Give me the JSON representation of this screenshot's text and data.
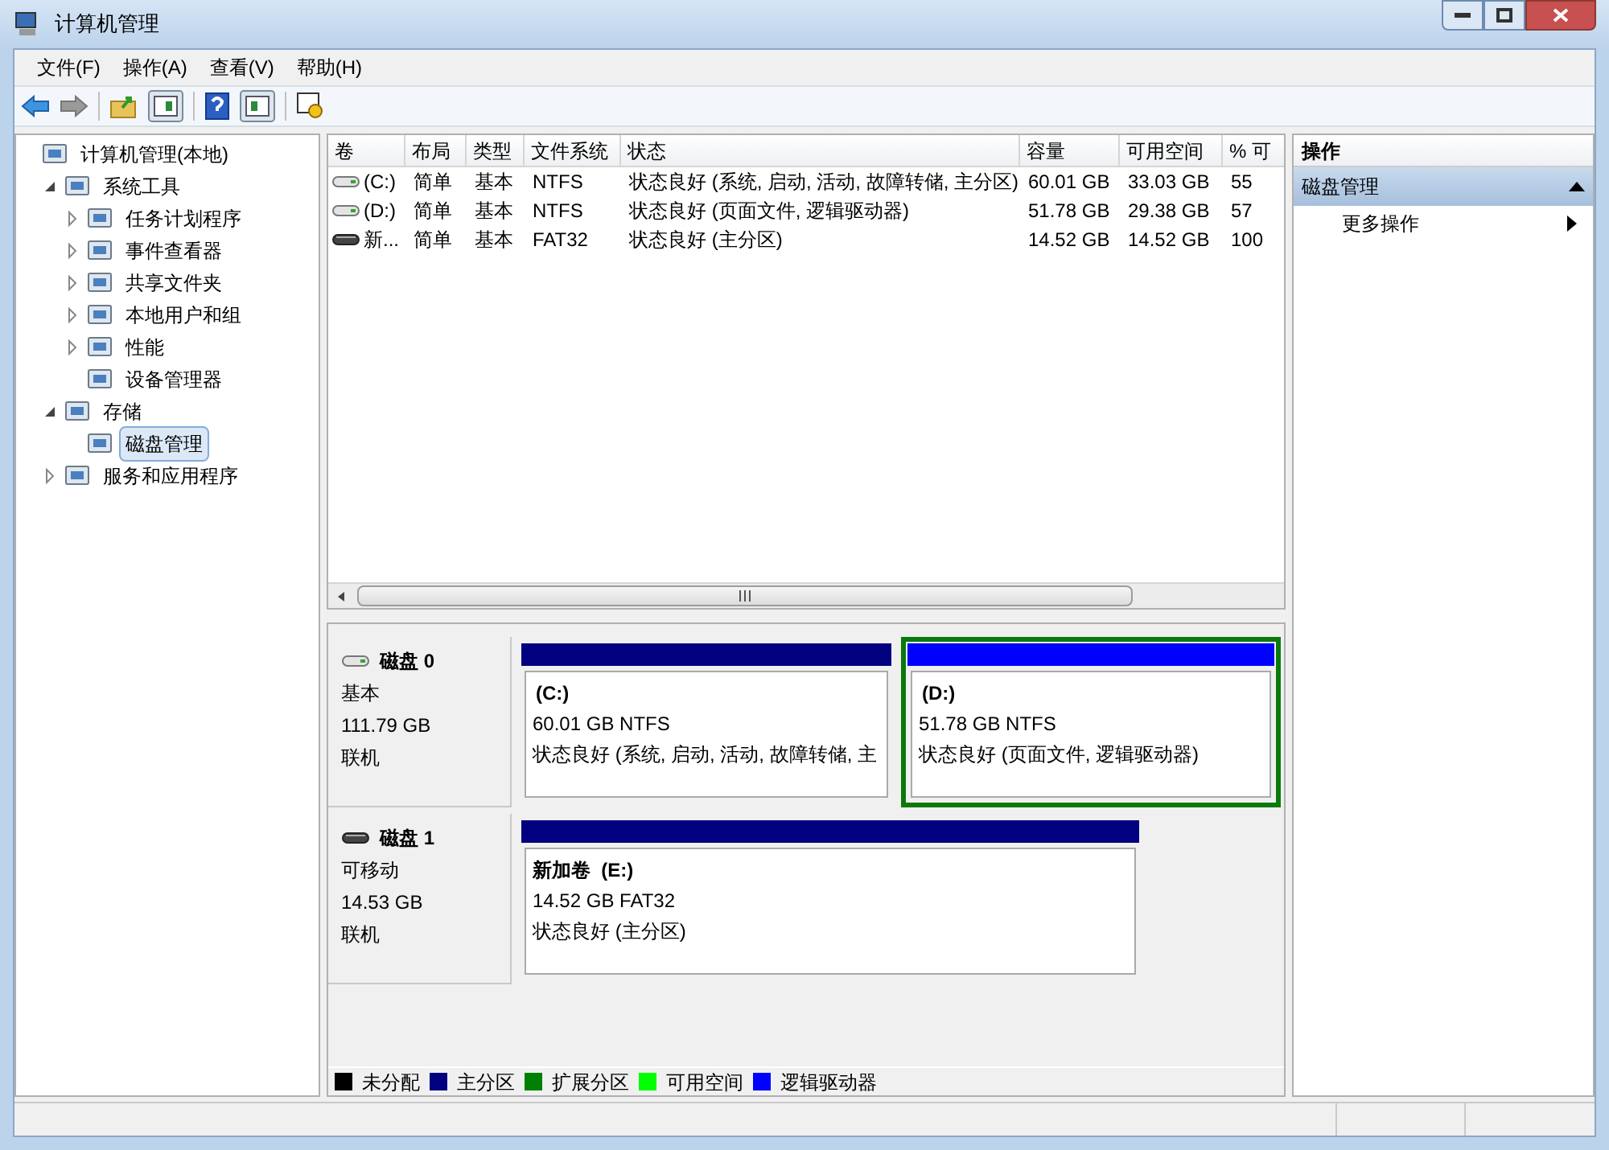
{
  "window": {
    "title": "计算机管理"
  },
  "menu": [
    "文件(F)",
    "操作(A)",
    "查看(V)",
    "帮助(H)"
  ],
  "tree": [
    {
      "label": "计算机管理(本地)",
      "selected": false,
      "children": [
        {
          "label": "系统工具",
          "expanded": true,
          "selected": false,
          "children": [
            {
              "label": "任务计划程序",
              "expanded": false,
              "selected": false
            },
            {
              "label": "事件查看器",
              "expanded": false,
              "selected": false
            },
            {
              "label": "共享文件夹",
              "expanded": false,
              "selected": false
            },
            {
              "label": "本地用户和组",
              "expanded": false,
              "selected": false
            },
            {
              "label": "性能",
              "expanded": false,
              "selected": false
            },
            {
              "label": "设备管理器",
              "selected": false
            }
          ]
        },
        {
          "label": "存储",
          "expanded": true,
          "selected": false,
          "children": [
            {
              "label": "磁盘管理",
              "selected": true
            }
          ]
        },
        {
          "label": "服务和应用程序",
          "expanded": false,
          "selected": false
        }
      ]
    }
  ],
  "volume_table": {
    "columns": [
      "卷",
      "布局",
      "类型",
      "文件系统",
      "状态",
      "容量",
      "可用空间",
      "% 可"
    ],
    "rows": [
      {
        "kind": "fixed",
        "cells": [
          "(C:)",
          "简单",
          "基本",
          "NTFS",
          "状态良好 (系统, 启动, 活动, 故障转储, 主分区)",
          "60.01 GB",
          "33.03 GB",
          "55"
        ]
      },
      {
        "kind": "fixed",
        "cells": [
          "(D:)",
          "简单",
          "基本",
          "NTFS",
          "状态良好 (页面文件, 逻辑驱动器)",
          "51.78 GB",
          "29.38 GB",
          "57"
        ]
      },
      {
        "kind": "removable",
        "cells": [
          "新...",
          "简单",
          "基本",
          "FAT32",
          "状态良好 (主分区)",
          "14.52 GB",
          "14.52 GB",
          "100"
        ]
      }
    ]
  },
  "disks": [
    {
      "kind": "fixed",
      "name": "磁盘 0",
      "type": "基本",
      "size": "111.79 GB",
      "status": "联机",
      "partitions": [
        {
          "kind": "primary",
          "selected": false,
          "name": "(C:)",
          "size": "60.01 GB NTFS",
          "status": "状态良好 (系统, 启动, 活动, 故障转储, 主"
        },
        {
          "kind": "logical",
          "selected": true,
          "name": "(D:)",
          "size": "51.78 GB NTFS",
          "status": "状态良好 (页面文件, 逻辑驱动器)"
        }
      ]
    },
    {
      "kind": "removable",
      "name": "磁盘 1",
      "type": "可移动",
      "size": "14.53 GB",
      "status": "联机",
      "partitions": [
        {
          "kind": "primary",
          "selected": false,
          "name": "新加卷  (E:)",
          "size": "14.52 GB FAT32",
          "status": "状态良好 (主分区)"
        }
      ]
    }
  ],
  "legend": [
    {
      "label": "未分配",
      "color": "#000000"
    },
    {
      "label": "主分区",
      "color": "#000080"
    },
    {
      "label": "扩展分区",
      "color": "#008000"
    },
    {
      "label": "可用空间",
      "color": "#00ff00"
    },
    {
      "label": "逻辑驱动器",
      "color": "#0000ff"
    }
  ],
  "actions": {
    "title": "操作",
    "section": "磁盘管理",
    "items": [
      "更多操作"
    ]
  }
}
